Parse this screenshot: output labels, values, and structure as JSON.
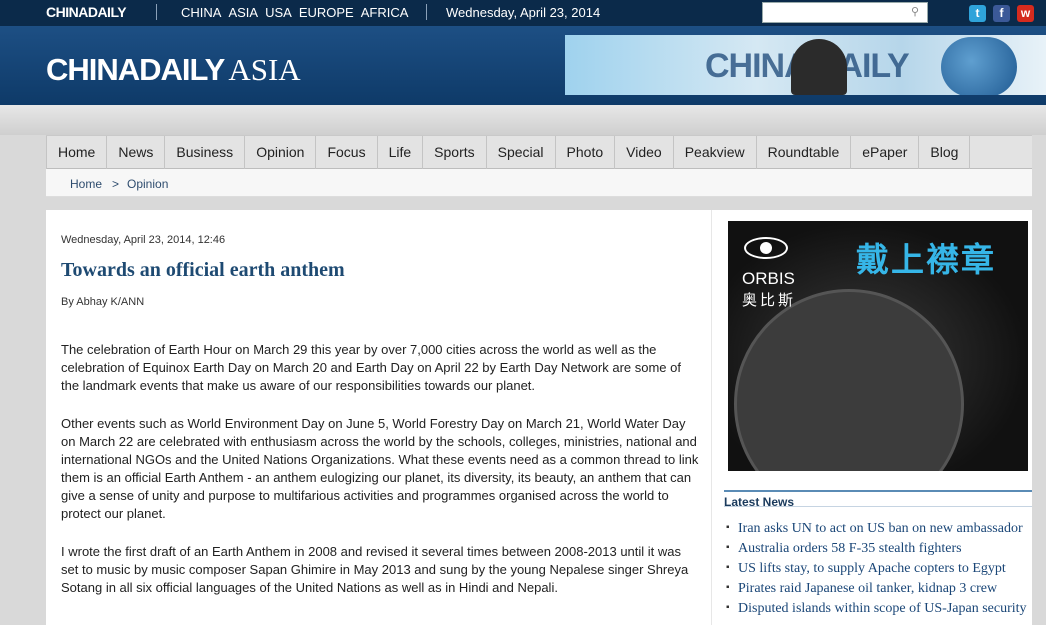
{
  "topbar": {
    "logo": "CHINADAILY",
    "regions": [
      "CHINA",
      "ASIA",
      "USA",
      "EUROPE",
      "AFRICA"
    ],
    "date": "Wednesday, April 23, 2014",
    "search_placeholder": "",
    "social": [
      {
        "name": "twitter-icon",
        "glyph": "t",
        "color": "#2fa3da"
      },
      {
        "name": "facebook-icon",
        "glyph": "f",
        "color": "#3b5998"
      },
      {
        "name": "weibo-icon",
        "glyph": "w",
        "color": "#d52b1e"
      }
    ]
  },
  "header": {
    "brand_main": "CHINADAILY",
    "brand_suffix": "ASIA",
    "banner_text": "CHINA DAILY"
  },
  "nav": {
    "items": [
      "Home",
      "News",
      "Business",
      "Opinion",
      "Focus",
      "Life",
      "Sports",
      "Special",
      "Photo",
      "Video",
      "Peakview",
      "Roundtable",
      "ePaper",
      "Blog"
    ]
  },
  "breadcrumb": {
    "home": "Home",
    "separator": ">",
    "current": "Opinion"
  },
  "article": {
    "datetime": "Wednesday, April 23, 2014, 12:46",
    "title": "Towards an official earth anthem",
    "byline": "By Abhay K/ANN",
    "paragraphs": [
      "The celebration of Earth Hour on March 29 this year by over 7,000 cities across the world as well as the celebration of Equinox Earth Day on March 20 and Earth Day on April 22 by Earth Day Network are some of the landmark events that make us aware of our responsibilities towards our planet.",
      "Other events such as World Environment Day on June 5,  World Forestry Day on March 21, World Water Day on March 22 are celebrated with enthusiasm across the world by the schools, colleges, ministries, national and international NGOs and the United Nations Organizations. What these events need as a common thread to link them is an official Earth Anthem - an anthem eulogizing our planet, its diversity, its beauty, an anthem that can give a sense of unity and purpose to multifarious activities and programmes organised across the world to protect our planet.",
      "I wrote the first draft of an Earth Anthem in 2008 and revised it several times between 2008-2013 until it was set to music by music composer Sapan Ghimire in May 2013 and sung by the young Nepalese singer Shreya Sotang in all six official languages of the United Nations as well as in Hindi and Nepali."
    ]
  },
  "ad": {
    "headline_cn": "戴上襟章",
    "orbis": "ORBIS",
    "orbis_cn": "奥比斯"
  },
  "latest_news": {
    "heading": "Latest News",
    "items": [
      "Iran asks UN to act on US ban on new ambassador",
      "Australia orders 58 F-35 stealth fighters",
      "US lifts stay, to supply Apache copters to Egypt",
      "Pirates raid Japanese oil tanker, kidnap 3 crew",
      "Disputed islands within scope of US-Japan security"
    ]
  }
}
